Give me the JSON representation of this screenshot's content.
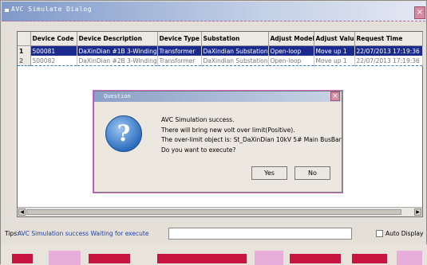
{
  "window": {
    "title": "AVC Simulate Dialog",
    "close": "×"
  },
  "grid": {
    "columns": [
      "",
      "Device Code",
      "Device Description",
      "Device Type",
      "Substation",
      "Adjust Model",
      "Adjust Value",
      "Request Time"
    ],
    "rows": [
      [
        "1",
        "500081",
        "DaXinDian #1B 3-Winding",
        "Transformer",
        "DaXindian Substation",
        "Open-loop",
        "Move up 1",
        "22/07/2013 17:19:36"
      ],
      [
        "2",
        "500082",
        "DaXinDian #2B 3-Winding",
        "Transformer",
        "DaXindian Substation",
        "Open-loop",
        "Move up 1",
        "22/07/2013 17:19:36"
      ]
    ]
  },
  "dialog": {
    "title": "Question",
    "close": "×",
    "icon": "question-icon",
    "lines": [
      "AVC Simulation success.",
      "There will bring new volt over limit(Positive).",
      "The over-limit object is: St_DaXinDian 10kV 5# Main BusBar",
      "Do you want to execute?"
    ],
    "yes_label": "Yes",
    "no_label": "No"
  },
  "status": {
    "tips_label": "Tips:",
    "tips_value": "AVC Simulation success Waiting for execute",
    "auto_display_label": "Auto Display"
  },
  "colors": {
    "selection": "#1b2a8e",
    "accent": "#c81440"
  }
}
